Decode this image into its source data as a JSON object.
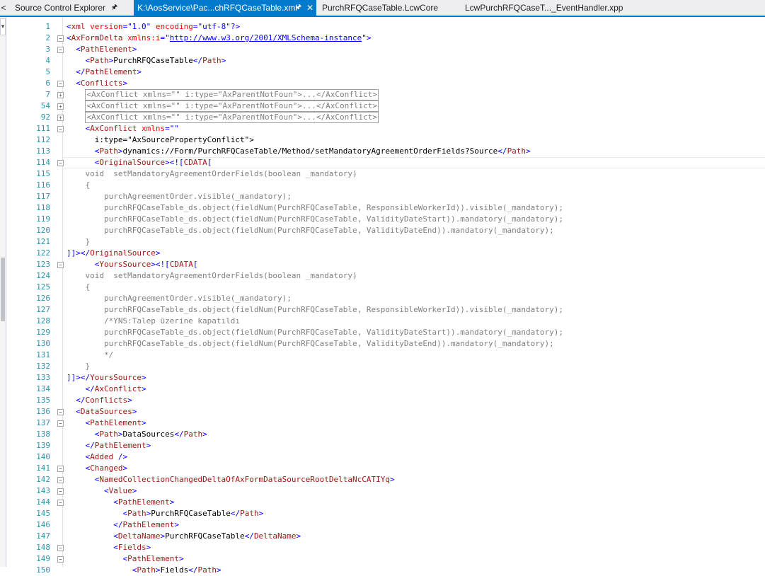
{
  "tabs": [
    {
      "label": "Source Control Explorer",
      "icon": "pin-icon",
      "active": false
    },
    {
      "label": "K:\\AosService\\Pac...chRFQCaseTable.xml",
      "icon": "pin-icon",
      "active": true
    },
    {
      "label": "PurchRFQCaseTable.LcwCore",
      "active": false
    },
    {
      "label": "LcwPurchRFQCaseT..._EventHandler.xpp",
      "active": false
    }
  ],
  "left_panel": {
    "dropdown_glyph": "▾",
    "arrow_glyph": "<"
  },
  "colors": {
    "accent": "#007acc",
    "line_number": "#2b91af",
    "tag": "#a31515",
    "attribute": "#ff0000",
    "value": "#0000ff",
    "text": "#000000",
    "cdata_text": "#808080"
  },
  "editor": {
    "lines": [
      {
        "n": "1",
        "fold": "",
        "t": "<?xml version=\"1.0\" encoding=\"utf-8\"?>",
        "k": "x"
      },
      {
        "n": "2",
        "fold": "box-minus",
        "t": "<AxFormDelta xmlns:i=\"http://www.w3.org/2001/XMLSchema-instance\">",
        "k": "x"
      },
      {
        "n": "3",
        "fold": "minus",
        "t": "  <PathElement>",
        "k": "x"
      },
      {
        "n": "4",
        "fold": "",
        "t": "    <Path>PurchRFQCaseTable</Path>",
        "k": "x"
      },
      {
        "n": "5",
        "fold": "",
        "t": "  </PathElement>",
        "k": "x"
      },
      {
        "n": "6",
        "fold": "minus",
        "t": "  <Conflicts>",
        "k": "x"
      },
      {
        "n": "7",
        "fold": "plus",
        "t": "    <AxConflict xmlns=\"\" i:type=\"AxParentNotFoun\">...</AxConflict>",
        "k": "b"
      },
      {
        "n": "54",
        "fold": "plus",
        "t": "    <AxConflict xmlns=\"\" i:type=\"AxParentNotFoun\">...</AxConflict>",
        "k": "b"
      },
      {
        "n": "92",
        "fold": "plus",
        "t": "    <AxConflict xmlns=\"\" i:type=\"AxParentNotFoun\">...</AxConflict>",
        "k": "b"
      },
      {
        "n": "111",
        "fold": "minus",
        "t": "    <AxConflict xmlns=\"\"",
        "k": "x"
      },
      {
        "n": "112",
        "fold": "",
        "t": "      i:type=\"AxSourcePropertyConflict\">",
        "k": "x"
      },
      {
        "n": "113",
        "fold": "",
        "t": "      <Path>dynamics://Form/PurchRFQCaseTable/Method/setMandatoryAgreementOrderFields?Source</Path>",
        "k": "x"
      },
      {
        "n": "114",
        "fold": "minus",
        "t": "      <OriginalSource><![CDATA[",
        "k": "x",
        "hl": true
      },
      {
        "n": "115",
        "fold": "",
        "t": "    void  setMandatoryAgreementOrderFields(boolean _mandatory)",
        "k": "c"
      },
      {
        "n": "116",
        "fold": "",
        "t": "    {",
        "k": "c"
      },
      {
        "n": "117",
        "fold": "",
        "t": "        purchAgreementOrder.visible(_mandatory);",
        "k": "c"
      },
      {
        "n": "118",
        "fold": "",
        "t": "        purchRFQCaseTable_ds.object(fieldNum(PurchRFQCaseTable, ResponsibleWorkerId)).visible(_mandatory);",
        "k": "c"
      },
      {
        "n": "119",
        "fold": "",
        "t": "        purchRFQCaseTable_ds.object(fieldNum(PurchRFQCaseTable, ValidityDateStart)).mandatory(_mandatory);",
        "k": "c"
      },
      {
        "n": "120",
        "fold": "",
        "t": "        purchRFQCaseTable_ds.object(fieldNum(PurchRFQCaseTable, ValidityDateEnd)).mandatory(_mandatory);",
        "k": "c"
      },
      {
        "n": "121",
        "fold": "",
        "t": "    }",
        "k": "c"
      },
      {
        "n": "122",
        "fold": "",
        "t": "]]></OriginalSource>",
        "k": "x"
      },
      {
        "n": "123",
        "fold": "minus",
        "t": "      <YoursSource><![CDATA[",
        "k": "x"
      },
      {
        "n": "124",
        "fold": "",
        "t": "    void  setMandatoryAgreementOrderFields(boolean _mandatory)",
        "k": "c"
      },
      {
        "n": "125",
        "fold": "",
        "t": "    {",
        "k": "c"
      },
      {
        "n": "126",
        "fold": "",
        "t": "        purchAgreementOrder.visible(_mandatory);",
        "k": "c"
      },
      {
        "n": "127",
        "fold": "",
        "t": "        purchRFQCaseTable_ds.object(fieldNum(PurchRFQCaseTable, ResponsibleWorkerId)).visible(_mandatory);",
        "k": "c"
      },
      {
        "n": "128",
        "fold": "",
        "t": "        /*YNS:Talep üzerine kapatıldı",
        "k": "c"
      },
      {
        "n": "129",
        "fold": "",
        "t": "        purchRFQCaseTable_ds.object(fieldNum(PurchRFQCaseTable, ValidityDateStart)).mandatory(_mandatory);",
        "k": "c"
      },
      {
        "n": "130",
        "fold": "",
        "t": "        purchRFQCaseTable_ds.object(fieldNum(PurchRFQCaseTable, ValidityDateEnd)).mandatory(_mandatory);",
        "k": "c"
      },
      {
        "n": "131",
        "fold": "",
        "t": "        */",
        "k": "c"
      },
      {
        "n": "132",
        "fold": "",
        "t": "    }",
        "k": "c"
      },
      {
        "n": "133",
        "fold": "",
        "t": "]]></YoursSource>",
        "k": "x"
      },
      {
        "n": "134",
        "fold": "",
        "t": "    </AxConflict>",
        "k": "x"
      },
      {
        "n": "135",
        "fold": "",
        "t": "  </Conflicts>",
        "k": "x"
      },
      {
        "n": "136",
        "fold": "minus",
        "t": "  <DataSources>",
        "k": "x"
      },
      {
        "n": "137",
        "fold": "minus",
        "t": "    <PathElement>",
        "k": "x"
      },
      {
        "n": "138",
        "fold": "",
        "t": "      <Path>DataSources</Path>",
        "k": "x"
      },
      {
        "n": "139",
        "fold": "",
        "t": "    </PathElement>",
        "k": "x"
      },
      {
        "n": "140",
        "fold": "",
        "t": "    <Added />",
        "k": "x"
      },
      {
        "n": "141",
        "fold": "minus",
        "t": "    <Changed>",
        "k": "x"
      },
      {
        "n": "142",
        "fold": "minus",
        "t": "      <NamedCollectionChangedDeltaOfAxFormDataSourceRootDeltaNcCATIYq>",
        "k": "x"
      },
      {
        "n": "143",
        "fold": "minus",
        "t": "        <Value>",
        "k": "x"
      },
      {
        "n": "144",
        "fold": "minus",
        "t": "          <PathElement>",
        "k": "x"
      },
      {
        "n": "145",
        "fold": "",
        "t": "            <Path>PurchRFQCaseTable</Path>",
        "k": "x"
      },
      {
        "n": "146",
        "fold": "",
        "t": "          </PathElement>",
        "k": "x"
      },
      {
        "n": "147",
        "fold": "",
        "t": "          <DeltaName>PurchRFQCaseTable</DeltaName>",
        "k": "x"
      },
      {
        "n": "148",
        "fold": "minus",
        "t": "          <Fields>",
        "k": "x"
      },
      {
        "n": "149",
        "fold": "minus",
        "t": "            <PathElement>",
        "k": "x"
      },
      {
        "n": "150",
        "fold": "",
        "t": "              <Path>Fields</Path>",
        "k": "x"
      }
    ]
  }
}
